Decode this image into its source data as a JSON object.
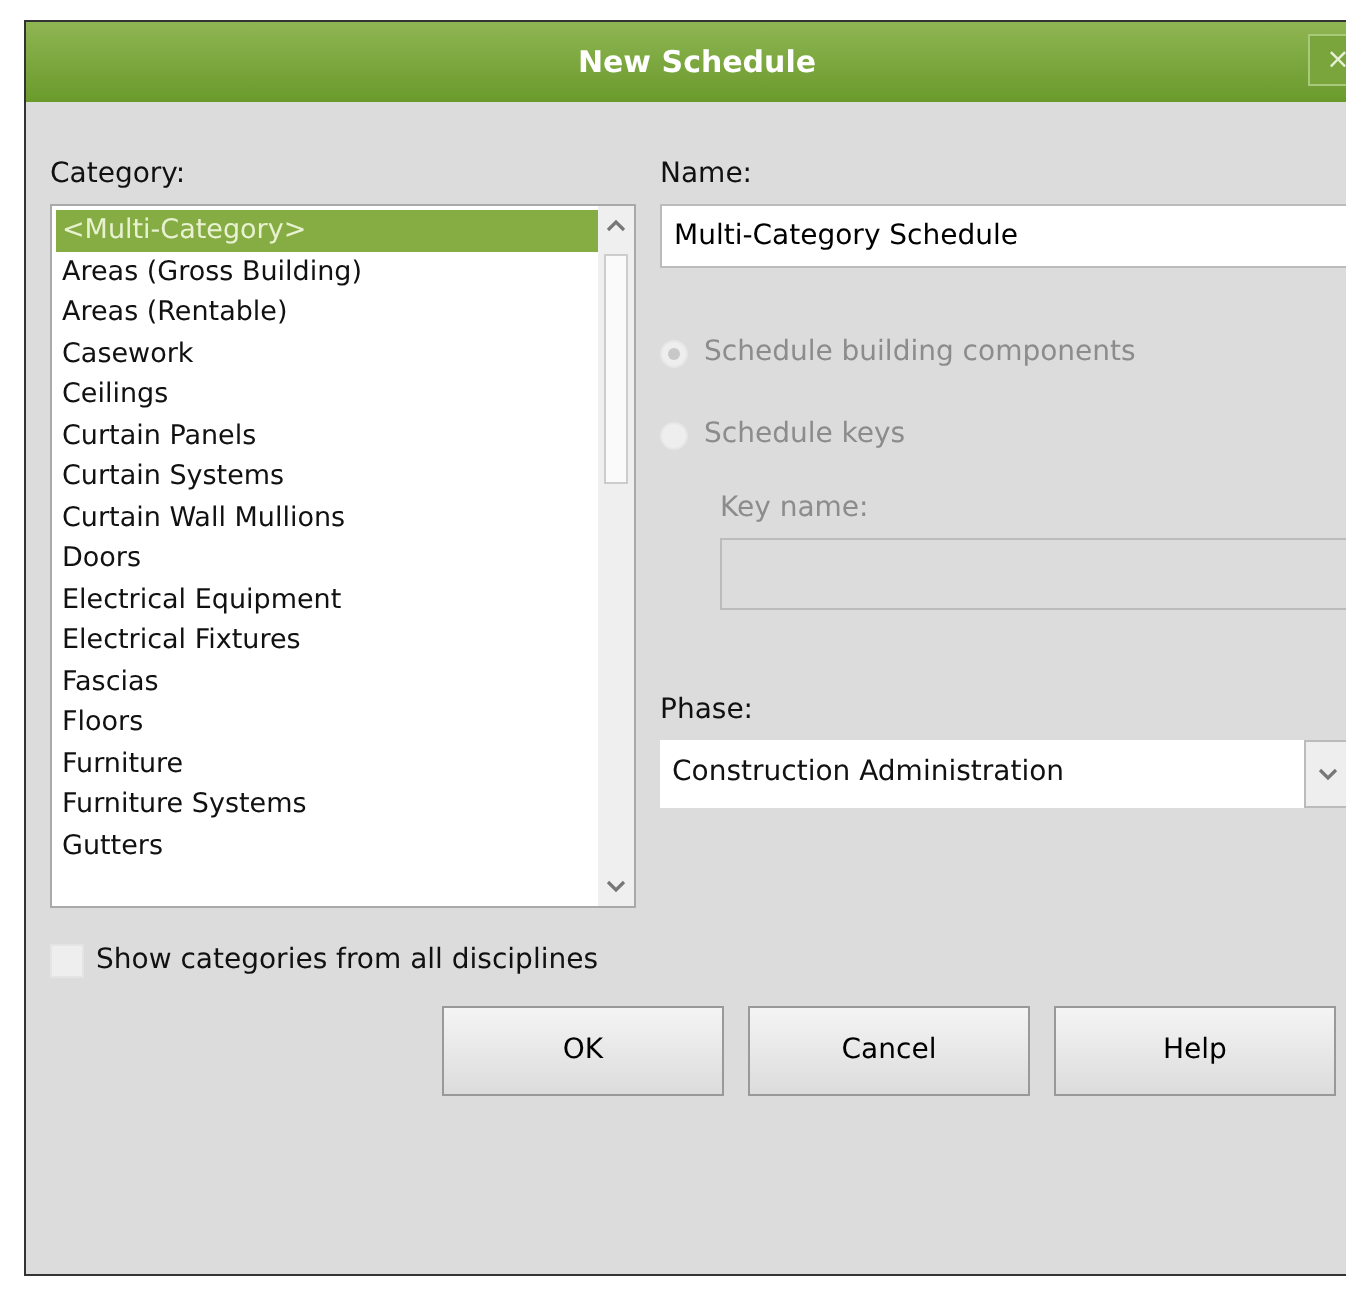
{
  "window": {
    "title": "New Schedule",
    "close": "×"
  },
  "category": {
    "label": "Category:",
    "items": [
      {
        "text": "<Multi-Category>",
        "selected": true
      },
      {
        "text": "Areas (Gross Building)",
        "selected": false
      },
      {
        "text": "Areas (Rentable)",
        "selected": false
      },
      {
        "text": "Casework",
        "selected": false
      },
      {
        "text": "Ceilings",
        "selected": false
      },
      {
        "text": "Curtain Panels",
        "selected": false
      },
      {
        "text": "Curtain Systems",
        "selected": false
      },
      {
        "text": "Curtain Wall Mullions",
        "selected": false
      },
      {
        "text": "Doors",
        "selected": false
      },
      {
        "text": "Electrical Equipment",
        "selected": false
      },
      {
        "text": "Electrical Fixtures",
        "selected": false
      },
      {
        "text": "Fascias",
        "selected": false
      },
      {
        "text": "Floors",
        "selected": false
      },
      {
        "text": "Furniture",
        "selected": false
      },
      {
        "text": "Furniture Systems",
        "selected": false
      },
      {
        "text": "Gutters",
        "selected": false
      }
    ],
    "show_all": {
      "label": "Show categories from all disciplines",
      "checked": false
    }
  },
  "name": {
    "label": "Name:",
    "value": "Multi-Category Schedule"
  },
  "schedule_type": [
    {
      "label": "Schedule building components",
      "selected": true,
      "disabled": true
    },
    {
      "label": "Schedule keys",
      "selected": false,
      "disabled": true
    }
  ],
  "key_name": {
    "label": "Key name:",
    "disabled": true
  },
  "phase": {
    "label": "Phase:",
    "value": "Construction Administration"
  },
  "buttons": [
    "OK",
    "Cancel",
    "Help"
  ]
}
